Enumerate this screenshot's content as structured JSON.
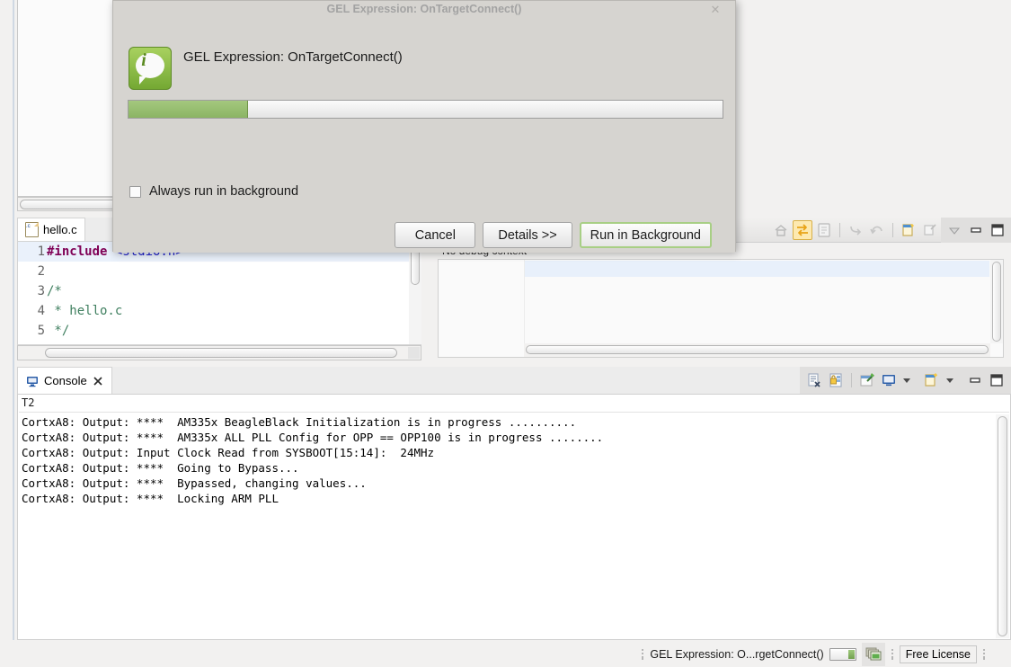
{
  "dialog": {
    "title": "GEL Expression: OnTargetConnect()",
    "message": "GEL Expression: OnTargetConnect()",
    "icon": "info-bubble-icon",
    "close_label": "✕",
    "progress_percent": 20,
    "checkbox": {
      "label": "Always run in background",
      "checked": false
    },
    "buttons": [
      {
        "label": "Cancel",
        "name": "cancel-button",
        "default": false
      },
      {
        "label": "Details >>",
        "name": "details-button",
        "default": false
      },
      {
        "label": "Run in Background",
        "name": "run-in-background-button",
        "default": true
      }
    ]
  },
  "editor": {
    "tabs": [
      {
        "label": "hello.c",
        "ext": ".c",
        "active": true
      },
      {
        "label": "",
        "ext": ".S",
        "active": false
      }
    ],
    "lines": [
      {
        "num": "1",
        "highlight": true,
        "parts": [
          {
            "t": "#include ",
            "c": "kw-pp"
          },
          {
            "t": "<stdio.h>",
            "c": "kw-inc"
          }
        ]
      },
      {
        "num": "2",
        "highlight": false,
        "parts": [
          {
            "t": "",
            "c": "kw-plain"
          }
        ]
      },
      {
        "num": "3",
        "highlight": false,
        "parts": [
          {
            "t": "/*",
            "c": "kw-cmt"
          }
        ]
      },
      {
        "num": "4",
        "highlight": false,
        "parts": [
          {
            "t": " * hello.c",
            "c": "kw-cmt"
          }
        ]
      },
      {
        "num": "5",
        "highlight": false,
        "parts": [
          {
            "t": " */",
            "c": "kw-cmt"
          }
        ]
      }
    ]
  },
  "debug_panel": {
    "status_text": "No debug context",
    "toolbar_icons": [
      "home-icon",
      "swap-arrows-icon",
      "copy-expression-icon",
      "step-return-icon",
      "refresh-icon",
      "new-note-icon",
      "edit-note-icon",
      "view-menu-icon",
      "minimize-icon",
      "maximize-icon"
    ]
  },
  "console": {
    "tab_label": "Console",
    "tab_icon": "console-monitor-icon",
    "close_icon": "close-icon",
    "header": "T2",
    "lines": [
      "CortxA8: Output: ****  AM335x BeagleBlack Initialization is in progress ..........",
      "CortxA8: Output: ****  AM335x ALL PLL Config for OPP == OPP100 is in progress ........",
      "CortxA8: Output: Input Clock Read from SYSBOOT[15:14]:  24MHz",
      "CortxA8: Output: ****  Going to Bypass...",
      "CortxA8: Output: ****  Bypassed, changing values...",
      "CortxA8: Output: ****  Locking ARM PLL"
    ],
    "toolbar_icons": [
      "clear-console-icon",
      "lock-scroll-icon",
      "pin-console-icon",
      "display-console-icon",
      "display-dropdown-icon",
      "open-console-icon",
      "open-console-dropdown-icon",
      "minimize-icon",
      "maximize-icon"
    ]
  },
  "statusbar": {
    "job_text": "GEL Expression: O...rgetConnect()",
    "progress_percent": 20,
    "windows_icon": "stacked-windows-icon",
    "license_text": "Free License"
  },
  "colors": {
    "dialog_bg": "#d6d4d0",
    "progress_fill": "#8cb764",
    "default_button_border": "#a8cf85",
    "icon_green": "#8ec248",
    "code_preprocessor": "#7f0055",
    "code_include": "#2222cc",
    "code_comment": "#3f7f5f",
    "row_highlight": "#e8f0fb"
  }
}
